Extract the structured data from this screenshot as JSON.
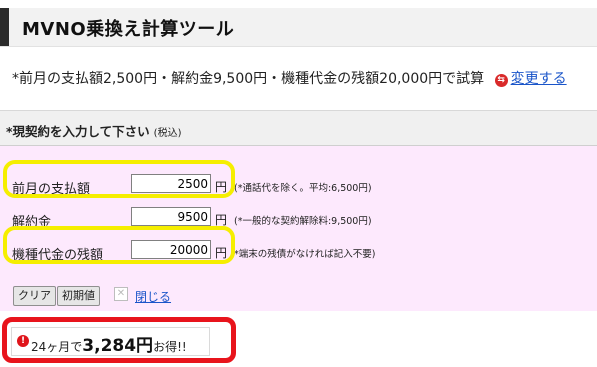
{
  "title": "MVNO乗換え計算ツール",
  "summary": {
    "text": "*前月の支払額2,500円・解約金9,500円・機種代金の残額20,000円で試算",
    "change_link": "変更する"
  },
  "form": {
    "heading": "*現契約を入力して下さい",
    "tax_note": "(税込)",
    "rows": [
      {
        "label": "前月の支払額",
        "value": "2500",
        "unit": "円",
        "note": "(*通話代を除く。平均:6,500円)"
      },
      {
        "label": "解約金",
        "value": "9500",
        "unit": "円",
        "note": "(*一般的な契約解除料:9,500円)"
      },
      {
        "label": "機種代金の残額",
        "value": "20000",
        "unit": "円",
        "note": "*端末の残債がなければ記入不要)"
      }
    ],
    "buttons": {
      "clear": "クリア",
      "reset": "初期値",
      "close": "閉じる"
    }
  },
  "result": {
    "prefix": "24ヶ月で",
    "amount": "3,284円",
    "suffix": "お得!!"
  },
  "colors": {
    "highlight_yellow": "#f5ee00",
    "highlight_red": "#e8141c",
    "panel_bg": "#fde9fd",
    "link": "#1a55c9"
  }
}
